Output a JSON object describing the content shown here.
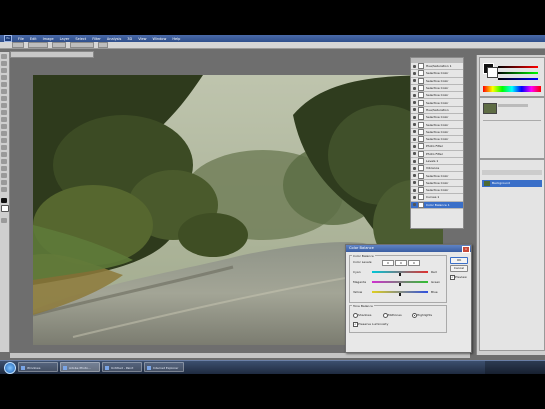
{
  "app": {
    "name": "Adobe Photoshop CS4",
    "logo_text": "Ps",
    "menus": [
      "File",
      "Edit",
      "Image",
      "Layer",
      "Select",
      "Filter",
      "Analysis",
      "3D",
      "View",
      "Window",
      "Help"
    ]
  },
  "layers": {
    "adjustment_layers": [
      "Hue/Saturation 1",
      "Selective Color",
      "Selective Color",
      "Selective Color",
      "Selective Color",
      "Selective Color",
      "Hue/Saturation",
      "Selective Color",
      "Selective Color",
      "Selective Color",
      "Selective Color",
      "Photo Filter",
      "Photo Filter",
      "Levels 1",
      "Vibrance",
      "Selective Color",
      "Selective Color",
      "Selective Color",
      "Curves 1",
      "Color Balance 1"
    ],
    "selected_index": 19,
    "mini_selected": "Background"
  },
  "color_balance": {
    "title": "Color Balance",
    "group_label": "Color Balance",
    "levels_label": "Color Levels:",
    "levels": [
      "0",
      "0",
      "0"
    ],
    "sliders": [
      {
        "left": "Cyan",
        "right": "Red",
        "value": 0
      },
      {
        "left": "Magenta",
        "right": "Green",
        "value": 0
      },
      {
        "left": "Yellow",
        "right": "Blue",
        "value": 0
      }
    ],
    "tone_label": "Tone Balance",
    "tones": [
      "Shadows",
      "Midtones",
      "Highlights"
    ],
    "tone_selected": "Highlights",
    "preserve_label": "Preserve Luminosity",
    "preserve_checked": true,
    "ok": "OK",
    "cancel": "Cancel",
    "preview": "Preview",
    "preview_checked": true
  },
  "taskbar": {
    "items": [
      "Windows",
      "Adobe Photo...",
      "Untitled - Paint",
      "Internet Explorer"
    ]
  },
  "colors": {
    "selection": "#3a6fc8",
    "taskbar": "#1f2b40"
  }
}
